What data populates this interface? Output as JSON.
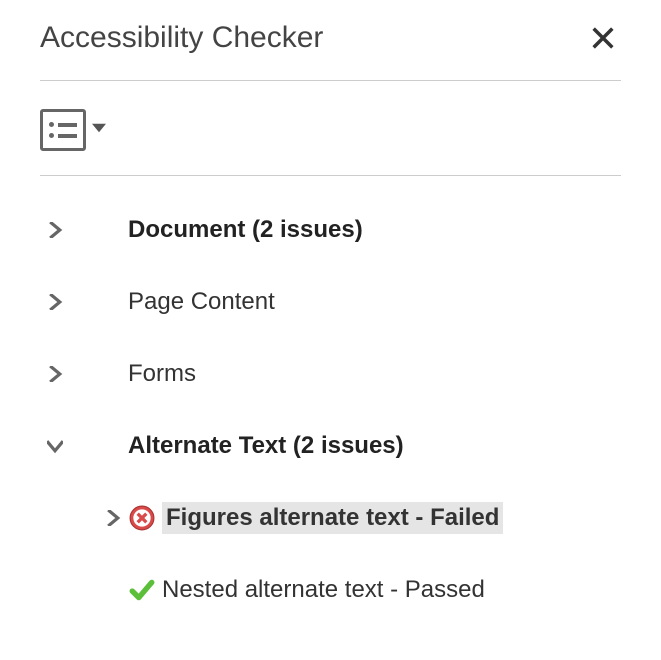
{
  "panel": {
    "title": "Accessibility Checker"
  },
  "tree": {
    "items": [
      {
        "label": "Document (2 issues)",
        "expanded": false,
        "bold": true
      },
      {
        "label": "Page Content",
        "expanded": false,
        "bold": false
      },
      {
        "label": "Forms",
        "expanded": false,
        "bold": false
      },
      {
        "label": "Alternate Text (2 issues)",
        "expanded": true,
        "bold": true
      }
    ],
    "alt_children": [
      {
        "label": "Figures alternate text - Failed",
        "status": "failed",
        "expandable": true,
        "selected": true
      },
      {
        "label": "Nested alternate text - Passed",
        "status": "passed",
        "expandable": false,
        "selected": false
      }
    ]
  }
}
